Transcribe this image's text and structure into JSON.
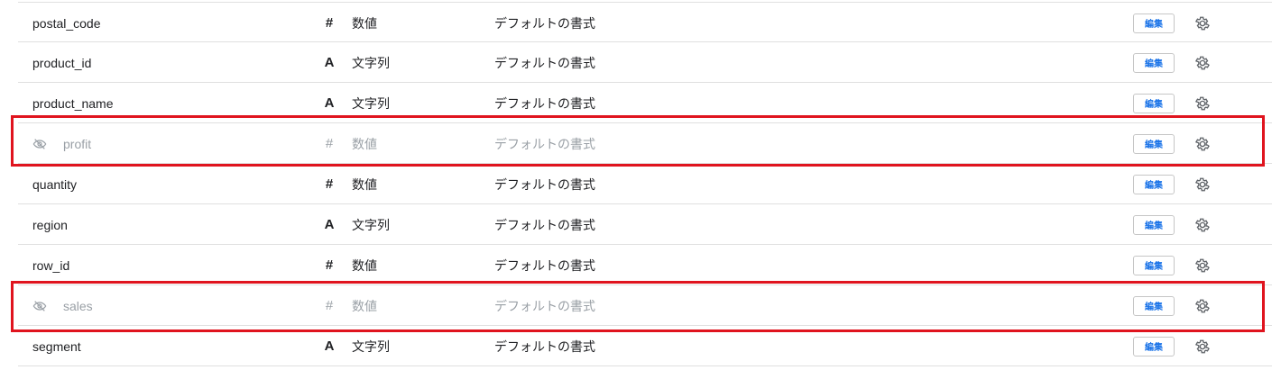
{
  "rows": [
    {
      "name": "postal_code",
      "type_icon": "#",
      "type": "数値",
      "format": "デフォルトの書式",
      "edit_label": "編集",
      "hidden": false
    },
    {
      "name": "product_id",
      "type_icon": "A",
      "type": "文字列",
      "format": "デフォルトの書式",
      "edit_label": "編集",
      "hidden": false
    },
    {
      "name": "product_name",
      "type_icon": "A",
      "type": "文字列",
      "format": "デフォルトの書式",
      "edit_label": "編集",
      "hidden": false
    },
    {
      "name": "profit",
      "type_icon": "#",
      "type": "数値",
      "format": "デフォルトの書式",
      "edit_label": "編集",
      "hidden": true
    },
    {
      "name": "quantity",
      "type_icon": "#",
      "type": "数値",
      "format": "デフォルトの書式",
      "edit_label": "編集",
      "hidden": false
    },
    {
      "name": "region",
      "type_icon": "A",
      "type": "文字列",
      "format": "デフォルトの書式",
      "edit_label": "編集",
      "hidden": false
    },
    {
      "name": "row_id",
      "type_icon": "#",
      "type": "数値",
      "format": "デフォルトの書式",
      "edit_label": "編集",
      "hidden": false
    },
    {
      "name": "sales",
      "type_icon": "#",
      "type": "数値",
      "format": "デフォルトの書式",
      "edit_label": "編集",
      "hidden": true
    },
    {
      "name": "segment",
      "type_icon": "A",
      "type": "文字列",
      "format": "デフォルトの書式",
      "edit_label": "編集",
      "hidden": false
    }
  ],
  "icons": {
    "hidden_indicator": "eye-off-icon",
    "settings": "gear-icon",
    "number_type": "hash-icon",
    "text_type": "letter-a-icon"
  },
  "colors": {
    "highlight_border": "#e0141e",
    "edit_text": "#1a73e8",
    "hidden_text": "#9aa0a6"
  }
}
